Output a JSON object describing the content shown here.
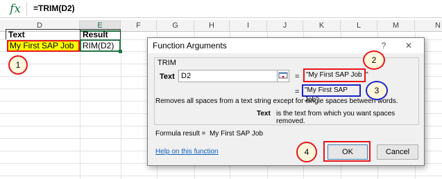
{
  "formula_bar": {
    "fx_label": "fx",
    "formula": "=TRIM(D2)"
  },
  "columns": [
    "D",
    "E",
    "F",
    "G",
    "H",
    "I",
    "J",
    "K",
    "L",
    "M",
    "N"
  ],
  "cells": {
    "d1": "Text",
    "e1": "Result",
    "d2": "My First SAP Job",
    "e2": "RIM(D2)"
  },
  "dialog": {
    "title": "Function Arguments",
    "help_glyph": "?",
    "close_glyph": "✕",
    "function_name": "TRIM",
    "arg_label": "Text",
    "arg_value": "D2",
    "eq1": "=",
    "arg_result": "\"My First SAP Job  \"",
    "eq2": "=",
    "func_result": "\"My First SAP Job\"",
    "description": "Removes all spaces from a text string except for single spaces between words.",
    "arg_help_name": "Text",
    "arg_help_text": "is the text from which you want spaces removed.",
    "formula_result_label": "Formula result =",
    "formula_result_value": "My First SAP Job",
    "help_link": "Help on this function",
    "ok_label": "OK",
    "cancel_label": "Cancel"
  },
  "markers": [
    "1",
    "2",
    "3",
    "4"
  ],
  "colors": {
    "excel_green": "#217346",
    "highlight": "#ffff00",
    "annotation_red": "#e8141a",
    "annotation_blue": "#1a22c8"
  }
}
